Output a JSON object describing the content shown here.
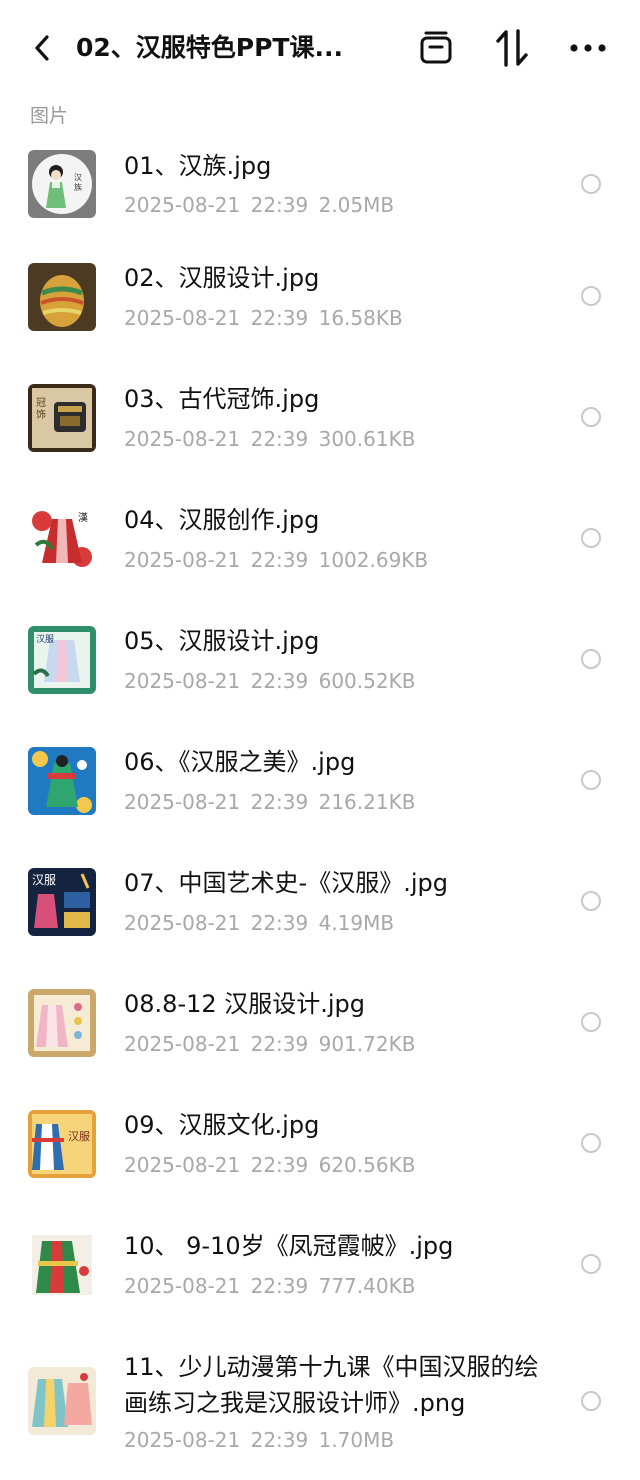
{
  "header": {
    "title": "02、汉服特色PPT课...",
    "back_icon": "chevron-left-icon",
    "archive_icon": "archive-box-icon",
    "sort_icon": "sort-arrows-icon",
    "more_icon": "more-dots-icon"
  },
  "section": {
    "label": "图片"
  },
  "files": [
    {
      "name": "01、汉族.jpg",
      "date": "2025-08-21",
      "time": "22:39",
      "size": "2.05MB"
    },
    {
      "name": "02、汉服设计.jpg",
      "date": "2025-08-21",
      "time": "22:39",
      "size": "16.58KB"
    },
    {
      "name": "03、古代冠饰.jpg",
      "date": "2025-08-21",
      "time": "22:39",
      "size": "300.61KB"
    },
    {
      "name": "04、汉服创作.jpg",
      "date": "2025-08-21",
      "time": "22:39",
      "size": "1002.69KB"
    },
    {
      "name": "05、汉服设计.jpg",
      "date": "2025-08-21",
      "time": "22:39",
      "size": "600.52KB"
    },
    {
      "name": "06、《汉服之美》.jpg",
      "date": "2025-08-21",
      "time": "22:39",
      "size": "216.21KB"
    },
    {
      "name": "07、中国艺术史-《汉服》.jpg",
      "date": "2025-08-21",
      "time": "22:39",
      "size": "4.19MB"
    },
    {
      "name": "08.8-12 汉服设计.jpg",
      "date": "2025-08-21",
      "time": "22:39",
      "size": "901.72KB"
    },
    {
      "name": "09、汉服文化.jpg",
      "date": "2025-08-21",
      "time": "22:39",
      "size": "620.56KB"
    },
    {
      "name": "10、 9-10岁《凤冠霞帔》.jpg",
      "date": "2025-08-21",
      "time": "22:39",
      "size": "777.40KB"
    },
    {
      "name": "11、少儿动漫第十九课《中国汉服的绘画练习之我是汉服设计师》.png",
      "date": "2025-08-21",
      "time": "22:39",
      "size": "1.70MB"
    }
  ],
  "colors": {
    "text_primary": "#111111",
    "text_secondary": "#a8a8a8",
    "radio_border": "#c9c9c9",
    "background": "#ffffff"
  }
}
